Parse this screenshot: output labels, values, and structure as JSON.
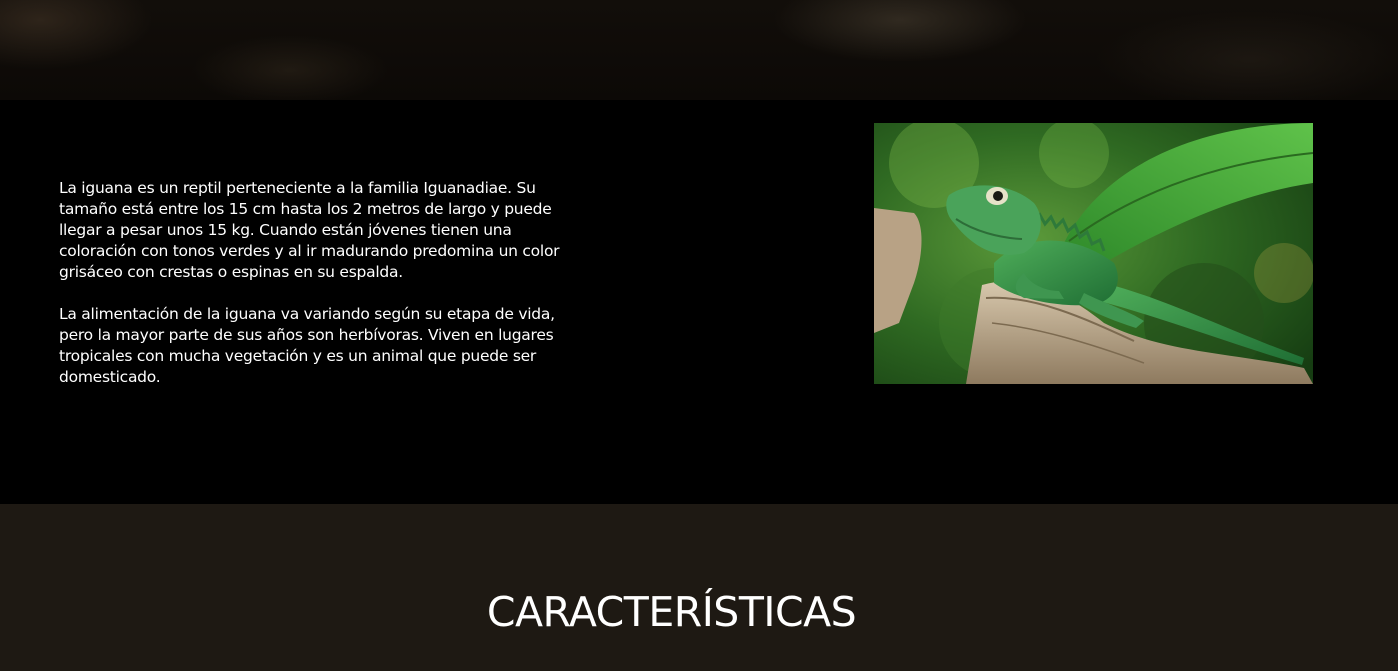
{
  "intro": {
    "paragraphs": [
      "La iguana es un reptil perteneciente a la familia Iguanadiae. Su tamaño está entre los 15 cm hasta los 2 metros de largo y puede llegar a pesar unos 15 kg. Cuando están jóvenes tienen una coloración con tonos verdes y al ir madurando predomina un color grisáceo con crestas o espinas en su espalda.",
      "La alimentación de la iguana va variando según su etapa de vida, pero la mayor parte de sus años son herbívoras. Viven en lugares tropicales con mucha vegetación y es un animal que puede ser domesticado."
    ],
    "photo_icon": "iguana-photo"
  },
  "features": {
    "title": "CARACTERÍSTICAS"
  },
  "colors": {
    "page_background": "#000000",
    "features_background": "#1e1913",
    "text": "#ffffff"
  }
}
